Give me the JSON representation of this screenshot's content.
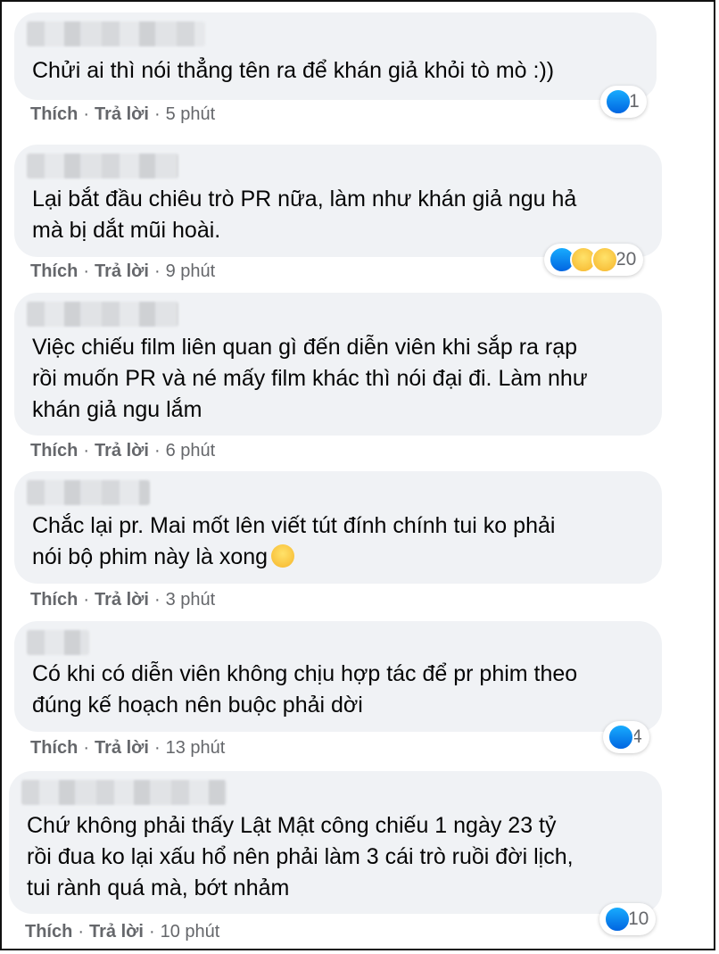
{
  "comments": [
    {
      "text": "Chửi ai thì nói thẳng tên ra để khán giả khỏi tò mò :))",
      "like": "Thích",
      "reply": "Trả lời",
      "time": "5 phút",
      "reactions": {
        "icons": [
          "like-icon"
        ],
        "count": "1"
      }
    },
    {
      "text": "Lại bắt đầu chiêu trò PR nữa, làm như khán giả ngu hả\nmà bị dắt mũi hoài.",
      "like": "Thích",
      "reply": "Trả lời",
      "time": "9 phút",
      "reactions": {
        "icons": [
          "like-icon",
          "haha-icon",
          "sad-icon"
        ],
        "count": "20"
      }
    },
    {
      "text": "Việc chiếu film liên quan gì đến diễn viên khi sắp ra rạp\nrồi muốn PR và né mấy film khác thì nói đại đi. Làm như\nkhán giả ngu lắm",
      "like": "Thích",
      "reply": "Trả lời",
      "time": "6 phút"
    },
    {
      "text": "Chắc lại pr. Mai mốt lên viết tút đính chính tui ko phải\nnói bộ phim này là xong",
      "emoji": "laughing-tears-emoji",
      "like": "Thích",
      "reply": "Trả lời",
      "time": "3 phút"
    },
    {
      "text": "Có khi có diễn viên không chịu hợp tác để pr phim theo\nđúng kế hoạch nên buộc phải dời",
      "like": "Thích",
      "reply": "Trả lời",
      "time": "13 phút",
      "reactions": {
        "icons": [
          "like-icon"
        ],
        "count": "4"
      }
    },
    {
      "text": "Chứ không phải thấy Lật Mật công chiếu 1 ngày 23 tỷ\nrồi đua ko lại xấu hổ nên phải làm 3 cái trò ruồi đời lịch,\ntui rành quá mà, bớt nhảm",
      "like": "Thích",
      "reply": "Trả lời",
      "time": "10 phút",
      "reactions": {
        "icons": [
          "like-icon"
        ],
        "count": "10"
      }
    }
  ],
  "colors": {
    "bubble": "#f0f2f5",
    "meta": "#65676b",
    "like_blue": "#1877f2"
  }
}
